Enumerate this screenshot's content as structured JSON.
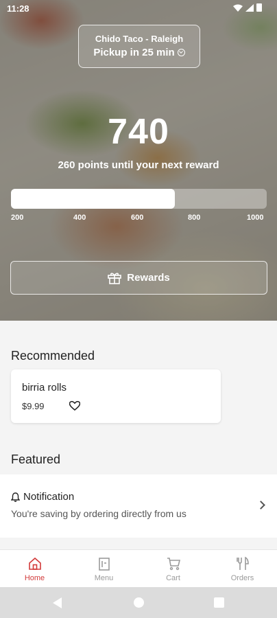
{
  "status_bar": {
    "time": "11:28"
  },
  "store": {
    "name": "Chido Taco - Raleigh",
    "pickup": "Pickup in 25 min"
  },
  "rewards": {
    "points": "740",
    "message": "260 points until your next reward",
    "progress_fraction": 0.64,
    "ticks": [
      "200",
      "400",
      "600",
      "800",
      "1000"
    ],
    "button_label": "Rewards"
  },
  "recommended": {
    "title": "Recommended",
    "items": [
      {
        "name": "birria rolls",
        "price": "$9.99"
      }
    ]
  },
  "featured": {
    "title": "Featured",
    "notification": {
      "title": "Notification",
      "body": "You're saving by ordering directly from us"
    }
  },
  "bottom_nav": {
    "items": [
      {
        "label": "Home",
        "icon": "home-icon",
        "active": true
      },
      {
        "label": "Menu",
        "icon": "menu-icon",
        "active": false
      },
      {
        "label": "Cart",
        "icon": "cart-icon",
        "active": false
      },
      {
        "label": "Orders",
        "icon": "orders-icon",
        "active": false
      }
    ]
  },
  "colors": {
    "accent": "#d23a3a"
  }
}
